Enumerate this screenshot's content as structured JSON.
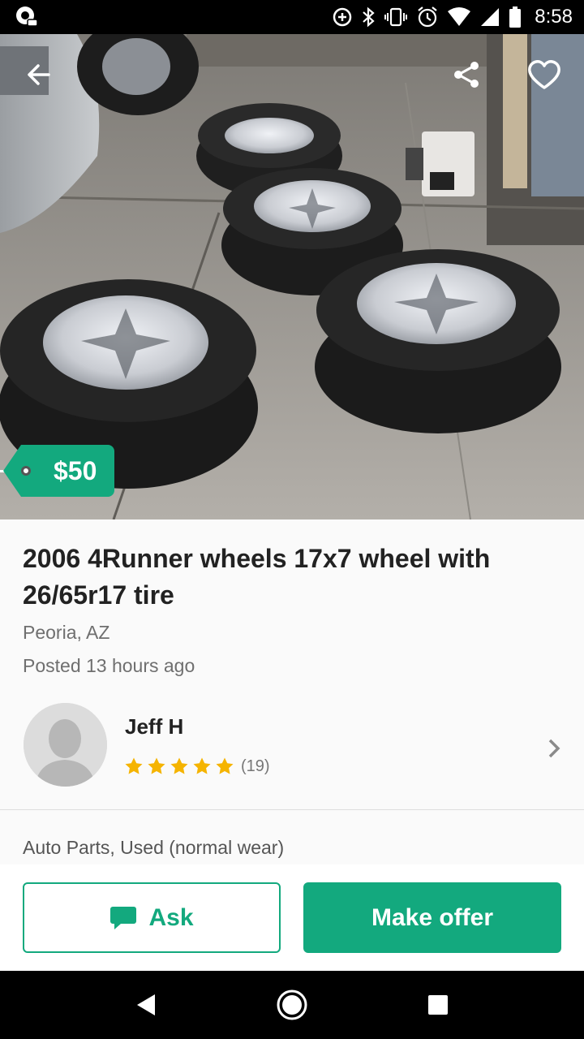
{
  "status_bar": {
    "time": "8:58",
    "icons": [
      "app-notification-icon",
      "data-saver-icon",
      "bluetooth-icon",
      "vibrate-icon",
      "alarm-icon",
      "wifi-icon",
      "signal-icon",
      "battery-icon"
    ]
  },
  "hero": {
    "price": "$50",
    "icons": {
      "back": "arrow-left-icon",
      "share": "share-icon",
      "favorite": "heart-icon"
    }
  },
  "listing": {
    "title": "2006 4Runner wheels 17x7 wheel with 26/65r17 tire",
    "location": "Peoria, AZ",
    "posted": "Posted 13 hours ago",
    "category": "Auto Parts, Used (normal wear)"
  },
  "seller": {
    "name": "Jeff H",
    "rating_stars": 5,
    "rating_count": "(19)"
  },
  "actions": {
    "ask_label": "Ask",
    "offer_label": "Make offer"
  },
  "colors": {
    "accent": "#13a97e",
    "star": "#f5b400"
  }
}
